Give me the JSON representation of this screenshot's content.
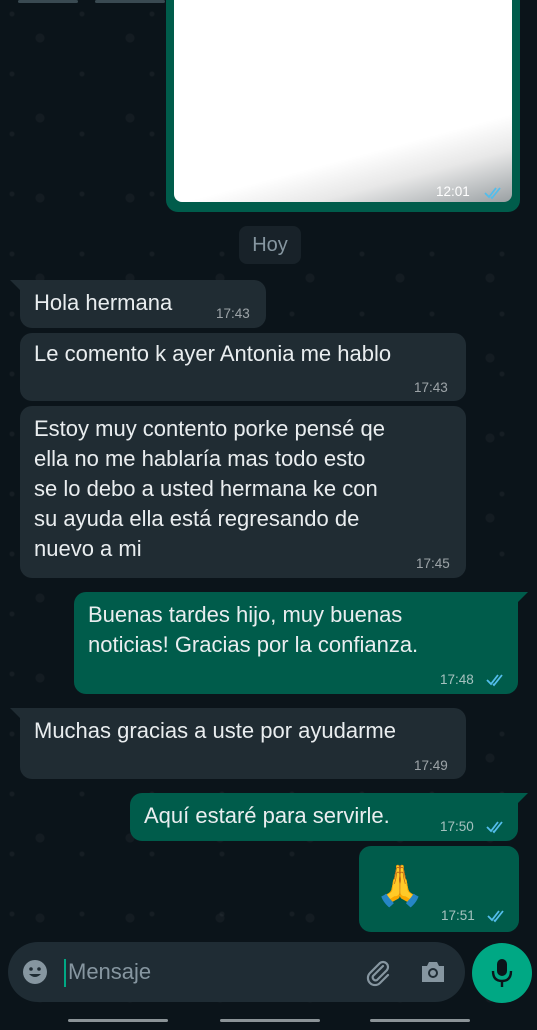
{
  "colors": {
    "background": "#0b141a",
    "incoming_bubble": "#202c33",
    "outgoing_bubble": "#005c4b",
    "read_ticks": "#53bdeb",
    "accent": "#00a884"
  },
  "image_message": {
    "time": "12:01",
    "status": "read"
  },
  "date_separator": "Hoy",
  "messages": [
    {
      "direction": "in",
      "text": "Hola hermana",
      "time": "17:43"
    },
    {
      "direction": "in",
      "text": "Le comento k ayer Antonia me hablo",
      "time": "17:43"
    },
    {
      "direction": "in",
      "text": "Estoy muy contento porke pensé qe\nella no me hablaría mas todo esto\nse lo debo a usted hermana ke con\nsu ayuda ella está regresando de\nnuevo a mi",
      "time": "17:45"
    },
    {
      "direction": "out",
      "text": "Buenas tardes hijo, muy buenas\nnoticias! Gracias por la confianza.",
      "time": "17:48",
      "status": "read"
    },
    {
      "direction": "in",
      "text": "Muchas gracias a uste por ayudarme",
      "time": "17:49"
    },
    {
      "direction": "out",
      "text": "Aquí estaré para servirle.",
      "time": "17:50",
      "status": "read"
    },
    {
      "direction": "out",
      "text": "🙏",
      "time": "17:51",
      "status": "read"
    }
  ],
  "composer": {
    "placeholder": "Mensaje",
    "icons": [
      "emoji-icon",
      "attach-icon",
      "camera-icon",
      "mic-icon"
    ]
  }
}
